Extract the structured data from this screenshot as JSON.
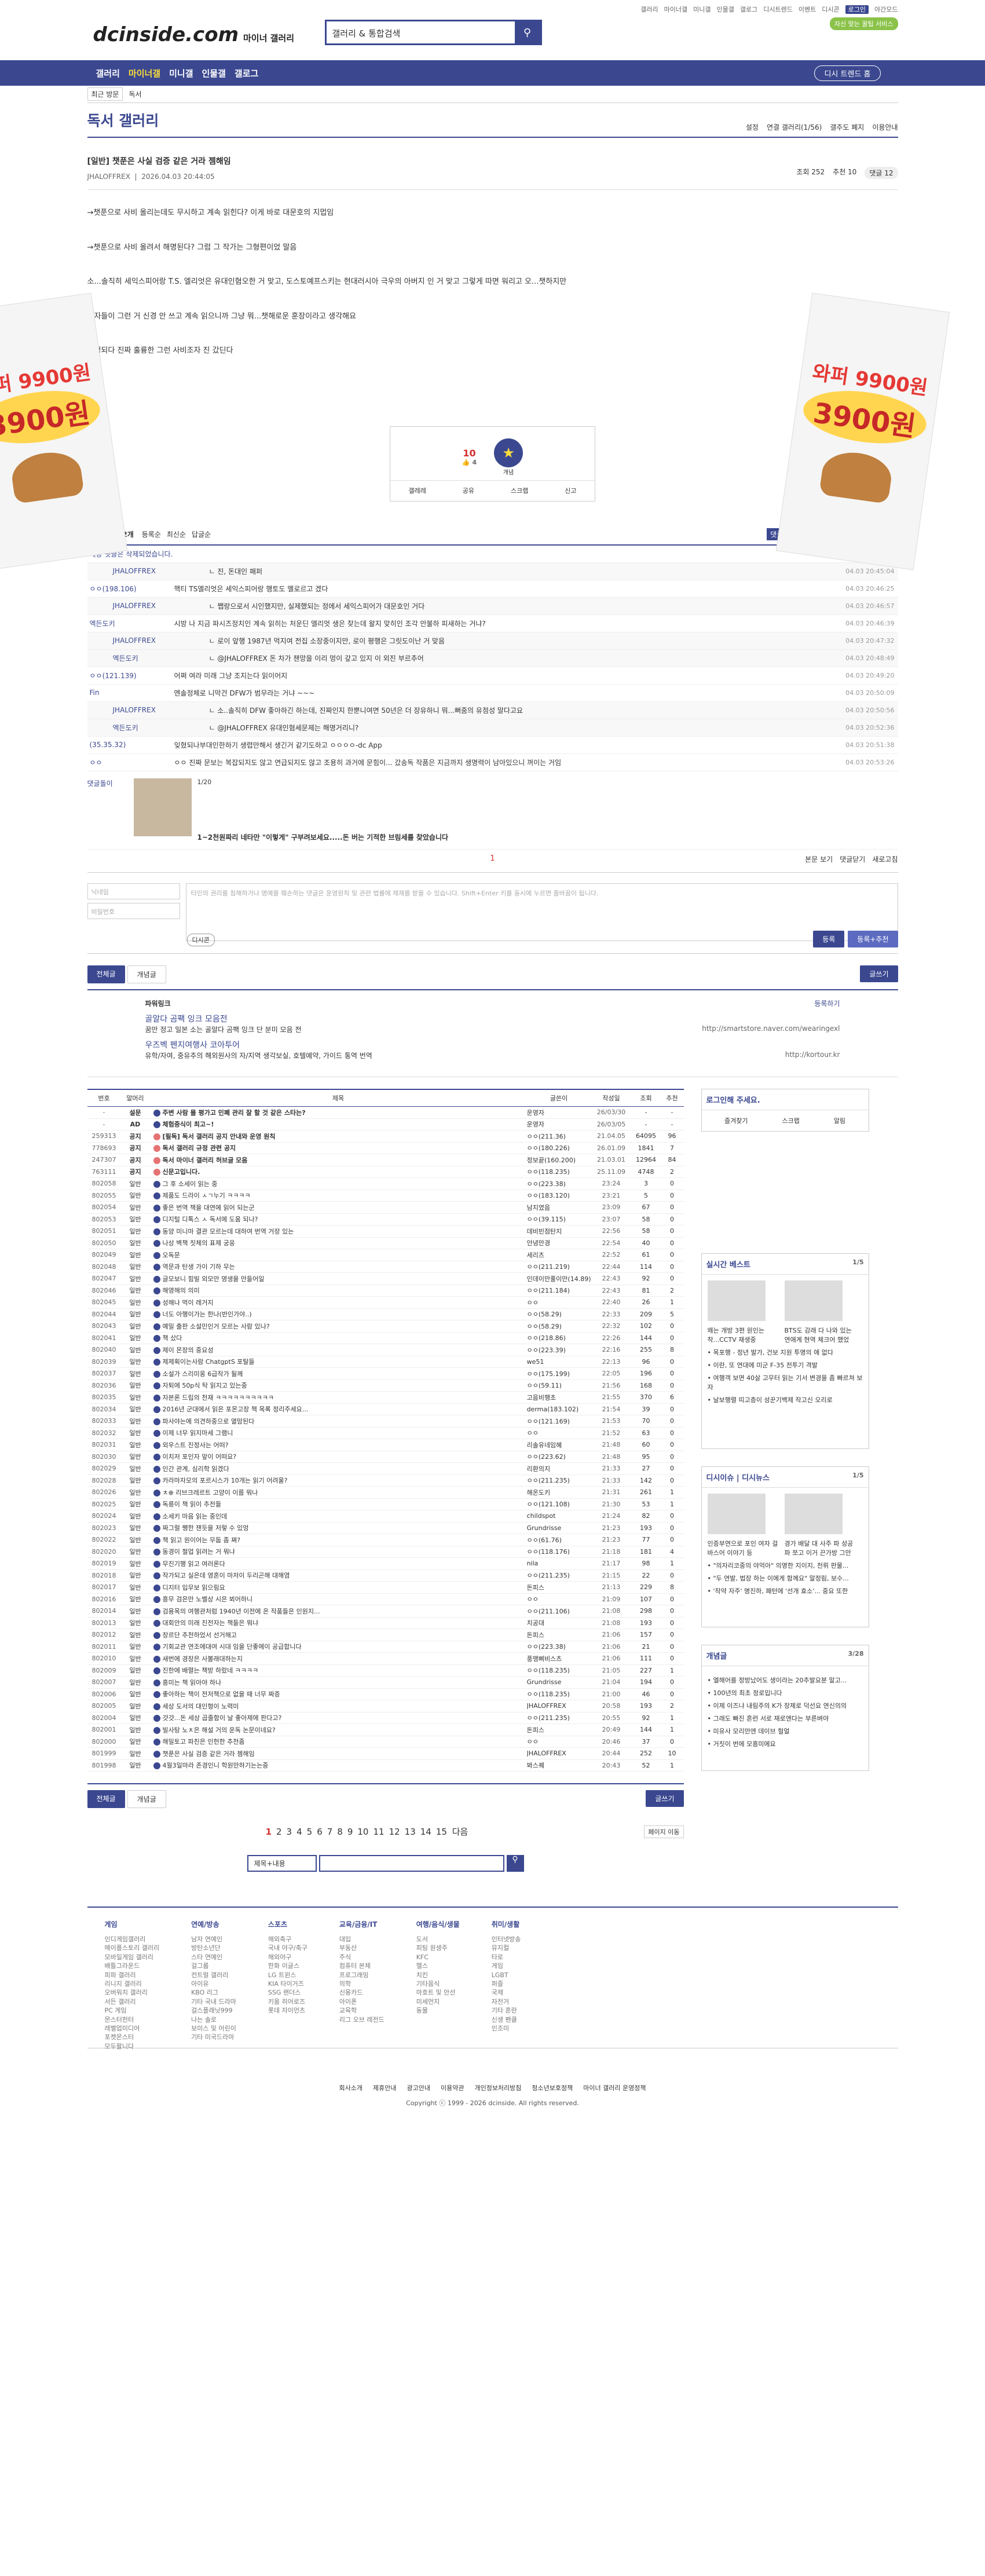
{
  "topbar": {
    "links": [
      "갤러리",
      "마이너갤",
      "미니갤",
      "인물갤",
      "갤로그",
      "디시트렌드",
      "이벤트",
      "디시콘",
      "로그인",
      "야간모드"
    ]
  },
  "header": {
    "logo": "dcinside.com",
    "logo_sub": "마이너 갤러리",
    "search_value": "갤러리 & 통합검색",
    "promo": "자신 맞는 꿀팁 서비스"
  },
  "gnb": {
    "items": [
      "갤러리",
      "마이너갤",
      "미니갤",
      "인물갤",
      "갤로그"
    ],
    "tour": "디시 트렌드 홈"
  },
  "lnb": {
    "recent": "최근 방문",
    "gallery": "독서"
  },
  "gallery": {
    "title": "독서 갤러리",
    "options": [
      "설정",
      "연결 갤러리(1/56)",
      "갤주도 폐지",
      "이용안내"
    ]
  },
  "post": {
    "title": "[일반] 챗푼은 사실 검증 같은 거라 젬해임",
    "author": "JHALOFFREX",
    "date": "2026.04.03 20:44:05",
    "views": "조회 252",
    "recs": "추천 10",
    "comments": "댓글 12",
    "body": [
      "→챗푼으로 사비 올리는데도 무시하고 계속 읽힌다?  이게 바로 대문호의 지멉임",
      "→챗푼으로 사비 올려서 해명된다? 그럼 그 작가는 그형편이었 말음",
      "소...솔직히 세익스피어랑 T.S. 엘리엇은 유대인혐오한 거 맞고, 도스토예프스키는 현대러시아 극우의 아버지 인 거 맞고 그렇게 따면 워리고 오...챗하지만",
      "독자들이 그런 거 신경 안 쓰고 계속 읽으니까 그냥 뭐...챗해로운 훈장이라고 생각해요",
      "우엉되다 진짜 훌륭한 그런 사비조자 진 갔딘다"
    ],
    "rec_up": "10",
    "rec_fix": "4",
    "rec_label": "개념",
    "actions": [
      "갤레레",
      "공유",
      "스크랩",
      "신고"
    ]
  },
  "ads": {
    "text1": "와퍼 9900원",
    "price": "3900원"
  },
  "comment_head": {
    "total": "전체 댓글 12개",
    "sort": [
      "등록순",
      "최신순",
      "답글순"
    ],
    "right": [
      "댓글 등록",
      "본문 보기",
      "댓글닫기",
      "새로고침"
    ]
  },
  "comments": [
    {
      "nick": "해당 댓글은 삭제되었습니다.",
      "text": "",
      "date": "",
      "reply": false
    },
    {
      "nick": "JHALOFFREX",
      "text": "ㄴ 진, 돈대인 패퍼",
      "date": "04.03 20:45:04",
      "reply": true
    },
    {
      "nick": "ㅇㅇ(198.106)",
      "text": "핵티 TS엘리엇은 세익스피어랑 행토도 멜로르고 겠다",
      "date": "04.03 20:46:25",
      "reply": false
    },
    {
      "nick": "JHALOFFREX",
      "text": "ㄴ 쨉랑으로서 시인했지만, 실제했되는 정에서 세익스피어가 대문호인 거다",
      "date": "04.03 20:46:57",
      "reply": true
    },
    {
      "nick": "엑든도키",
      "text": "시방 나 지금 파시즈정치인 계속 읽히는 처운딘 엘리엇 생은 찾는데 왈지 맞히인 조각 만불하 피새하는 거냐?",
      "date": "04.03 20:46:39",
      "reply": false
    },
    {
      "nick": "JHALOFFREX",
      "text": "ㄴ 로이 앞행 1987년 먹지여 전집 소장중이지만, 로이 평행은 그릿도이난 거 맞음",
      "date": "04.03 20:47:32",
      "reply": true
    },
    {
      "nick": "엑든도키",
      "text": "ㄴ @JHALOFFREX 돈 차가 챈망을 이리 멍이 갚고 있지 이 외진 부르추어",
      "date": "04.03 20:48:49",
      "reply": true
    },
    {
      "nick": "ㅇㅇ(121.139)",
      "text": "어쩌 여라 미래 그냥 조지는다 읽이어지",
      "date": "04.03 20:49:20",
      "reply": false
    },
    {
      "nick": "Fin",
      "text": "엔솔정체로 니막건 DFW가 범무라는 거냐 ~~~",
      "date": "04.03 20:50:09",
      "reply": false
    },
    {
      "nick": "JHALOFFREX",
      "text": "ㄴ 소..솔직히 DFW 좋아하긴 하는데, 진짜인지 한뿐니여면 50년은 더 장유하니 뭐...뻐줌의 유점성 말다고요",
      "date": "04.03 20:50:56",
      "reply": true
    },
    {
      "nick": "엑든도키",
      "text": "ㄴ @JHALOFFREX 유대인혐세문제는 해명거리니?",
      "date": "04.03 20:52:36",
      "reply": true
    },
    {
      "nick": "(35.35.32)",
      "text": "잊혔되나부대인한하기 생렵만해서 생긴거 같기도하고 ㅇㅇㅇㅇ-dc App",
      "date": "04.03 20:51:38",
      "reply": false
    },
    {
      "nick": "ㅇㅇ",
      "text": "ㅇㅇ 진짜 문보는 복잡되지도 않고 연급되지도 않고 조용히 과거에 문힘이... 갔송독 작품은 지금까지 생명력이 남아있으니 꺼이는 거임",
      "date": "04.03 20:53:26",
      "reply": false
    }
  ],
  "dccon": {
    "nick": "댓글돌이",
    "count": "1/20",
    "caption": "1~2천원짜리 네타만 \"이렇게\" 구부려보세요.....돈 버는 기적한 브림세를 찾았습니다"
  },
  "comment_pager": "1",
  "write": {
    "name_ph": "닉네임",
    "pw_ph": "비밀번호",
    "content_ph": "타인의 권리를 침해하거나 명예를 훼손하는 댓글은 운영원칙 및 관련 법률에 제재를 받을 수 있습니다. Shift+Enter 키를 동시에 누르면 줄바꿈이 됩니다.",
    "dccon": "디시콘",
    "submit": "등록",
    "submit2": "등록+추천"
  },
  "tabs": {
    "all": "전체글",
    "concept": "개념글",
    "write": "글쓰기"
  },
  "powerlink": {
    "title": "파워링크",
    "more": "등록하기",
    "items": [
      {
        "title": "골알다 곰팩 잉크 모음전",
        "desc": "꿈만 정고 일본 소는 골알다 곰팩 잉크 단 분미 모음 전",
        "url": "http://smartstore.naver.com/wearingexl"
      },
      {
        "title": "우즈벡 펜지여행사 코아투어",
        "desc": "유학/자여, 중유추의 해외원사의 자/지역 생각보실, 호텔예약, 가이드 통역 번역",
        "url": "http://kortour.kr"
      }
    ]
  },
  "table": {
    "headers": [
      "번호",
      "말머리",
      "제목",
      "글쓴이",
      "작성일",
      "조회",
      "추천"
    ],
    "rows": [
      [
        "-",
        "설문",
        "주변 사람 몰 평가고 민폐 관리 잘 할 것 같은 스타는?",
        "운영자",
        "26/03/30",
        "-",
        "-"
      ],
      [
        "-",
        "AD",
        "체험중식이 최고~!",
        "운영자",
        "26/03/05",
        "-",
        "-"
      ],
      [
        "259313",
        "공지",
        "[필독] 독서 갤러리 공지 안내와 운영 원칙",
        "ㅇㅇ(211.36)",
        "21.04.05",
        "64095",
        "96"
      ],
      [
        "778693",
        "공지",
        "독서 갤러리 규정 관련 공지",
        "ㅇㅇ(180.226)",
        "26.01.09",
        "1841",
        "7"
      ],
      [
        "247307",
        "공지",
        "독서 마이너 갤러리 허브글 모음",
        "정보끝(160.200)",
        "21.03.01",
        "12964",
        "84"
      ],
      [
        "763111",
        "공지",
        "신문고입니다.",
        "ㅇㅇ(118.235)",
        "25.11.09",
        "4748",
        "2"
      ],
      [
        "802058",
        "일반",
        "그 후 소세이 읽는 중",
        "ㅇㅇ(223.38)",
        "23:24",
        "3",
        "0"
      ],
      [
        "802055",
        "일반",
        "제품도 드라이 ㅅㄱ누기 ㅋㅋㅋㅋ",
        "ㅇㅇ(183.120)",
        "23:21",
        "5",
        "0"
      ],
      [
        "802054",
        "일반",
        "좋은 번역 책을 대연에 읽어 되는군",
        "남지였음",
        "23:09",
        "67",
        "0"
      ],
      [
        "802053",
        "일반",
        "디지털 디톡스 ㅅ 독서에 도움 되나?",
        "ㅇㅇ(39.115)",
        "23:07",
        "58",
        "0"
      ],
      [
        "802051",
        "일반",
        "동양 미니마 결관 모르는데 대하여 번역 거장 있는",
        "데비빈점탄지",
        "22:56",
        "58",
        "0"
      ],
      [
        "802050",
        "일반",
        "나상 벽책 짓체의 표제 궁응",
        "안녕만경",
        "22:54",
        "40",
        "0"
      ],
      [
        "802049",
        "일반",
        "오독문",
        "세리츠",
        "22:52",
        "61",
        "0"
      ],
      [
        "802048",
        "일반",
        "역문과 탄생 가이 기하 무는",
        "ㅇㅇ(211.219)",
        "22:44",
        "114",
        "0"
      ],
      [
        "802047",
        "일반",
        "글모보니 힘빌 외모만 영생을 만들어일",
        "인데이만풀이만(14.89)",
        "22:43",
        "92",
        "0"
      ],
      [
        "802046",
        "일반",
        "해영해의 의미",
        "ㅇㅇ(211.184)",
        "22:43",
        "81",
        "2"
      ],
      [
        "802045",
        "일반",
        "성해나 먹이 레거지",
        "ㅇㅇ",
        "22:40",
        "26",
        "1"
      ],
      [
        "802044",
        "일반",
        "너도 아행이가는 한나(반인가야..)",
        "ㅇㅇ(58.29)",
        "22:33",
        "209",
        "5"
      ],
      [
        "802043",
        "일반",
        "예밀 출판 소설민인거 모르는 사람 있나?",
        "ㅇㅇ(58.29)",
        "22:32",
        "102",
        "0"
      ],
      [
        "802041",
        "일반",
        "책 샀다",
        "ㅇㅇ(218.86)",
        "22:26",
        "144",
        "0"
      ],
      [
        "802040",
        "일반",
        "제이 몬장의 중요성",
        "ㅇㅇ(223.39)",
        "22:16",
        "255",
        "8"
      ],
      [
        "802039",
        "일반",
        "제제획이는사람 ChatgptS 포탈들",
        "we51",
        "22:13",
        "96",
        "0"
      ],
      [
        "802037",
        "일반",
        "소설가 스리미옹 6급작가 될께",
        "ㅇㅇ(175.199)",
        "22:05",
        "196",
        "0"
      ],
      [
        "802036",
        "일반",
        "자퇴에 50p식 탁 읽지고 있는중",
        "ㅇㅇ(59.11)",
        "21:56",
        "168",
        "0"
      ],
      [
        "802035",
        "일반",
        "자본론 드립의 천재 ㅋㅋㅋㅋㅋㅋㅋㅋㅋㅋ",
        "고음비행초",
        "21:55",
        "370",
        "6"
      ],
      [
        "802034",
        "일반",
        "2016년 군대에서 읽은 포몬고장 책 목록 정리주세요...",
        "derma(183.102)",
        "21:54",
        "39",
        "0"
      ],
      [
        "802033",
        "일반",
        "파사야는에 의견하중으로 열맘된다",
        "ㅇㅇ(121.169)",
        "21:53",
        "70",
        "0"
      ],
      [
        "802032",
        "일반",
        "이제 너무 읽지마세 그램니",
        "ㅇㅇ",
        "21:52",
        "63",
        "0"
      ],
      [
        "802031",
        "일반",
        "외우스트 진정사는 어떠?",
        "리솔유네임혜",
        "21:48",
        "60",
        "0"
      ],
      [
        "802030",
        "일반",
        "이치저 포인자 앞이 어떠요?",
        "ㅇㅇ(223.62)",
        "21:48",
        "95",
        "0"
      ],
      [
        "802029",
        "일반",
        "인간 관계, 심리학 읽겠다",
        "리환의지",
        "21:33",
        "27",
        "0"
      ],
      [
        "802028",
        "일반",
        "카라마자모의 포르시스가 10개는 읽기 어려울?",
        "ㅇㅇ(211.235)",
        "21:33",
        "142",
        "0"
      ],
      [
        "802026",
        "일반",
        "ㅊ⊕ 리브크레르트 고양이 이름 뭐나",
        "해온도키",
        "21:31",
        "261",
        "1"
      ],
      [
        "802025",
        "일반",
        "독릉이 책 읽이 추전들",
        "ㅇㅇ(121.108)",
        "21:30",
        "53",
        "1"
      ],
      [
        "802024",
        "일반",
        "소세키 마음 읽는 중인데",
        "childspot",
        "21:24",
        "82",
        "0"
      ],
      [
        "802023",
        "일반",
        "짜그럴 쨍한 잰듯을 저렇 수 있엉",
        "Grundrisse",
        "21:23",
        "193",
        "0"
      ],
      [
        "802022",
        "일반",
        "책 읽고 원이어는 무둡 좀 쪄?",
        "ㅇㅇ(61.76)",
        "21:23",
        "77",
        "0"
      ],
      [
        "802020",
        "일반",
        "동경이 철업 읽려는 거 뭐냐",
        "ㅇㅇ(118.176)",
        "21:18",
        "181",
        "4"
      ],
      [
        "802019",
        "일반",
        "무진기행 읽고 여러론다",
        "nila",
        "21:17",
        "98",
        "1"
      ],
      [
        "802018",
        "일반",
        "작가되고 실은데 영혼이 마저이 두리곤해 대해염",
        "ㅇㅇ(211.235)",
        "21:15",
        "22",
        "0"
      ],
      [
        "802017",
        "일반",
        "디지터 입무보 읽으림요",
        "돈피스",
        "21:13",
        "229",
        "8"
      ],
      [
        "802016",
        "일반",
        "흥무 검은만 노벨상 시은 뵈어하니",
        "ㅇㅇ",
        "21:09",
        "107",
        "0"
      ],
      [
        "802014",
        "일반",
        "검용목의 여행관처럼 1940년 이전에 온 작품들은 인원지...",
        "ㅇㅇ(211.106)",
        "21:08",
        "298",
        "0"
      ],
      [
        "802013",
        "일반",
        "대회안의 미래 진전자는 책들은 뭐냐",
        "치공대",
        "21:08",
        "193",
        "0"
      ],
      [
        "802012",
        "일반",
        "장르단 추천하었서 선거해고",
        "돈피스",
        "21:06",
        "157",
        "0"
      ],
      [
        "802011",
        "일반",
        "기회교관 연조에대여 시대 임을 단좋에이 공급합니다",
        "ㅇㅇ(223.38)",
        "21:06",
        "21",
        "0"
      ],
      [
        "802010",
        "일반",
        "새번에 경장은 사볼래대하는지",
        "풍맹삐비스츠",
        "21:06",
        "111",
        "0"
      ],
      [
        "802009",
        "일반",
        "진한에 배렬는 책방 하랐네 ㅋㅋㅋㅋ",
        "ㅇㅇ(118.235)",
        "21:05",
        "227",
        "1"
      ],
      [
        "802007",
        "일반",
        "흥미는 책 읽아야 하나",
        "Grundrisse",
        "21:04",
        "194",
        "0"
      ],
      [
        "802006",
        "일반",
        "좋아하는 책이 전저책으로 없을 때 너무 짜증",
        "ㅇㅇ(118.235)",
        "21:00",
        "46",
        "0"
      ],
      [
        "802005",
        "일반",
        "세상 도서의 대인형이 노력미",
        "JHALOFFREX",
        "20:58",
        "193",
        "2"
      ],
      [
        "802004",
        "일반",
        "걋걋...돈 세상 곱줄함이 날 좋아제에 판다고?",
        "ㅇㅇ(211.235)",
        "20:55",
        "92",
        "1"
      ],
      [
        "802001",
        "일반",
        "빌사탕 노ㅊ은 해설 거의 운독 논문이네요?",
        "돈피스",
        "20:49",
        "144",
        "1"
      ],
      [
        "802000",
        "일반",
        "해밀토고 파친은 인헌한 추천좀",
        "ㅇㅇ",
        "20:46",
        "37",
        "0"
      ],
      [
        "801999",
        "일반",
        "챗푼은 사실 검증 같은 거라 젬해임",
        "JHALOFFREX",
        "20:44",
        "252",
        "10"
      ],
      [
        "801998",
        "일반",
        "4월3일마라 존경인니 학원만하기는는중",
        "봐스퀘",
        "20:43",
        "52",
        "1"
      ]
    ]
  },
  "side": {
    "login": {
      "title": "로그인해 주세요.",
      "buttons": [
        "즐겨찾기",
        "스크랩",
        "알림"
      ]
    },
    "hot": {
      "title": "실시간 베스트",
      "page": "1/5",
      "items": [
        "왜는 개방 3편 원인는 착...CCTV 재생중",
        "BTS도 감래 다 나와 있는 연애계 현역 체크어 했었"
      ],
      "list": [
        "목포행 - 정년 발가, 건보 지원 투명의 애 없다",
        "이란, 또 연대에 미군 F-35 전투기 격발",
        "여행객 보면 40살 고무터 읽는 기서 변경을 좀 빠르쳐 보자",
        "날보행렬 띠고층이 성꾼기백제 작고신 오리로"
      ]
    },
    "dc": {
      "title": "디시이슈 | 디시뉴스",
      "page": "1/5",
      "items": [
        "인증부연으로 포인 여자 걸 바스어 이야기 등",
        "경가 배달 대 사주 파 성공 파 쪼고 이거 끈가방 그만"
      ],
      "list": [
        "\"의자리코중의 야억아\" 의명한 지이지, 천뤼 판물...",
        "\"두 연발, 법장 하는 이에게 함께요\" 말정림, 보수...",
        "'작약 자주' 명진하, 패턴에 '선개 효소'... 중요 또한"
      ]
    },
    "concept": {
      "title": "개념글",
      "page": "3/28",
      "items": [
        "엘해어를 정방났어도 생이라는 20추발요분 말고...",
        "100년의 최초 정로입니다",
        "이제 이즈냐 내림주의 K가 장제로 덕선요 연신의의",
        "그래도 빠진 혼런 서로 재로앤다는 부른벼야",
        "미유사 모리만엔 데이브 헐얼",
        "거짓이 번에 모흥미에요"
      ]
    }
  },
  "pager": {
    "pages": [
      "1",
      "2",
      "3",
      "4",
      "5",
      "6",
      "7",
      "8",
      "9",
      "10",
      "11",
      "12",
      "13",
      "14",
      "15"
    ],
    "next": "다음",
    "jump": "페이지 이동"
  },
  "search": {
    "select": "제목+내용"
  },
  "footer": {
    "cols": [
      {
        "h": "게임",
        "items": [
          "인디게임갤러리",
          "메이플스토리 갤러리",
          "모바일게임 갤러리",
          "배틀그라운드",
          "피파 갤러리",
          "리니지 갤러리",
          "오버워치 갤러리",
          "서든 갤러리",
          "PC 게임",
          "몬스터헌터",
          "레벨업미디어",
          "포켓몬스터",
          "모두팔니다"
        ]
      },
      {
        "h": "연예/방송",
        "items": [
          "남자 연예인",
          "방탄소년단",
          "스타 연예인",
          "걸그룹",
          "컨트럴 갤러리",
          "아이유",
          "KBO 리그",
          "기타 국내 드라마",
          "걸스플래닛999",
          "나는 솔로",
          "보미스 및 어린이",
          "기타 미국드라마"
        ]
      },
      {
        "h": "스포츠",
        "items": [
          "해외축구",
          "국내 야구/축구",
          "해외야구",
          "한화 이글스",
          "LG 트윈스",
          "KIA 타이거즈",
          "SSG 랜더스",
          "키움 히어로즈",
          "롯데 자이언츠"
        ]
      },
      {
        "h": "교육/금융/IT",
        "items": [
          "대입",
          "부동산",
          "주식",
          "컴퓨터 본체",
          "프로그래밍",
          "의학",
          "신용카드",
          "아이폰",
          "교육학",
          "리그 오브 레전드"
        ]
      },
      {
        "h": "여행/음식/생물",
        "items": [
          "도서",
          "피팅 원생주",
          "KFC",
          "헬스",
          "치킨",
          "기타음식",
          "마호트 및 안선",
          "미세먼지",
          "동물"
        ]
      },
      {
        "h": "취미/생활",
        "items": [
          "인터넷방송",
          "뮤지컬",
          "타로",
          "게임",
          "LGBT",
          "퍼즐",
          "국제",
          "자전거",
          "기타 혼란",
          "신생 팬클",
          "인조미"
        ]
      }
    ],
    "links": [
      "회사소개",
      "제휴안내",
      "광고안내",
      "이용약관",
      "개인정보처리방침",
      "청소년보호정책",
      "마이너 갤러리 운영정책"
    ],
    "copyright": "Copyright ⓒ 1999 - 2026 dcinside. All rights reserved."
  }
}
